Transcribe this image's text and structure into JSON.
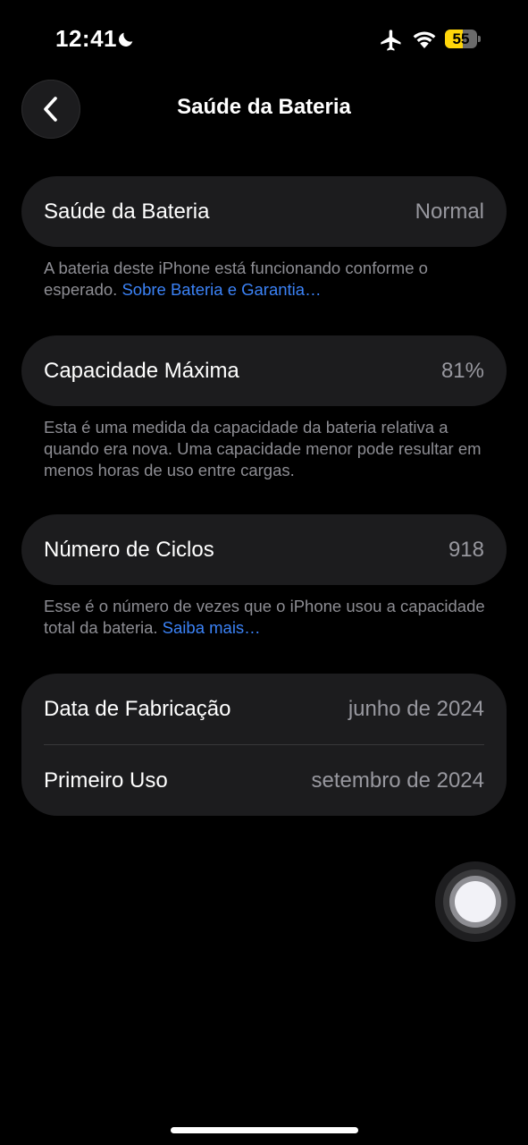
{
  "status_bar": {
    "time": "12:41",
    "battery_level": "55",
    "battery_fraction": 0.55,
    "icons": [
      "moon-icon",
      "airplane-icon",
      "wifi-icon",
      "battery-icon"
    ]
  },
  "nav": {
    "title": "Saúde da Bateria",
    "back_icon": "chevron-left-icon"
  },
  "sections": {
    "health": {
      "label": "Saúde da Bateria",
      "value": "Normal",
      "footnote_text": "A bateria deste iPhone está funcionando conforme o esperado. ",
      "footnote_link": "Sobre Bateria e Garantia…"
    },
    "capacity": {
      "label": "Capacidade Máxima",
      "value": "81%",
      "footnote_text": "Esta é uma medida da capacidade da bateria relativa a quando era nova. Uma capacidade menor pode resultar em menos horas de uso entre cargas."
    },
    "cycles": {
      "label": "Número de Ciclos",
      "value": "918",
      "footnote_text": "Esse é o número de vezes que o iPhone usou a capacidade total da bateria. ",
      "footnote_link": "Saiba mais…"
    },
    "dates": {
      "manufacture_label": "Data de Fabricação",
      "manufacture_value": "junho de 2024",
      "first_use_label": "Primeiro Uso",
      "first_use_value": "setembro de 2024"
    }
  },
  "colors": {
    "background": "#000000",
    "card": "#1c1c1e",
    "secondary_text": "#98989f",
    "link": "#3b82f6",
    "battery_accent": "#ffd60a"
  }
}
